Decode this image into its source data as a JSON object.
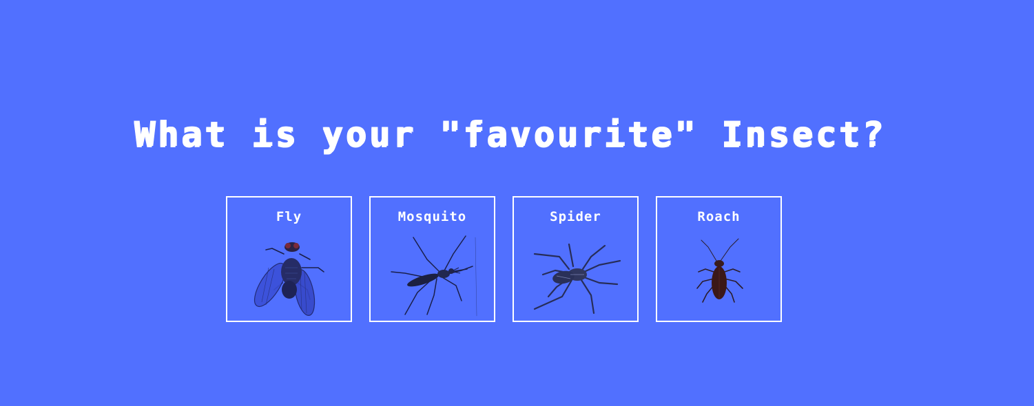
{
  "page": {
    "title": "What is your \"favourite\" Insect?",
    "background_color": "#5170ff",
    "foreground_color": "#ffffff"
  },
  "options": [
    {
      "label": "Fly",
      "icon": "fly-icon"
    },
    {
      "label": "Mosquito",
      "icon": "mosquito-icon"
    },
    {
      "label": "Spider",
      "icon": "spider-icon"
    },
    {
      "label": "Roach",
      "icon": "roach-icon"
    }
  ]
}
